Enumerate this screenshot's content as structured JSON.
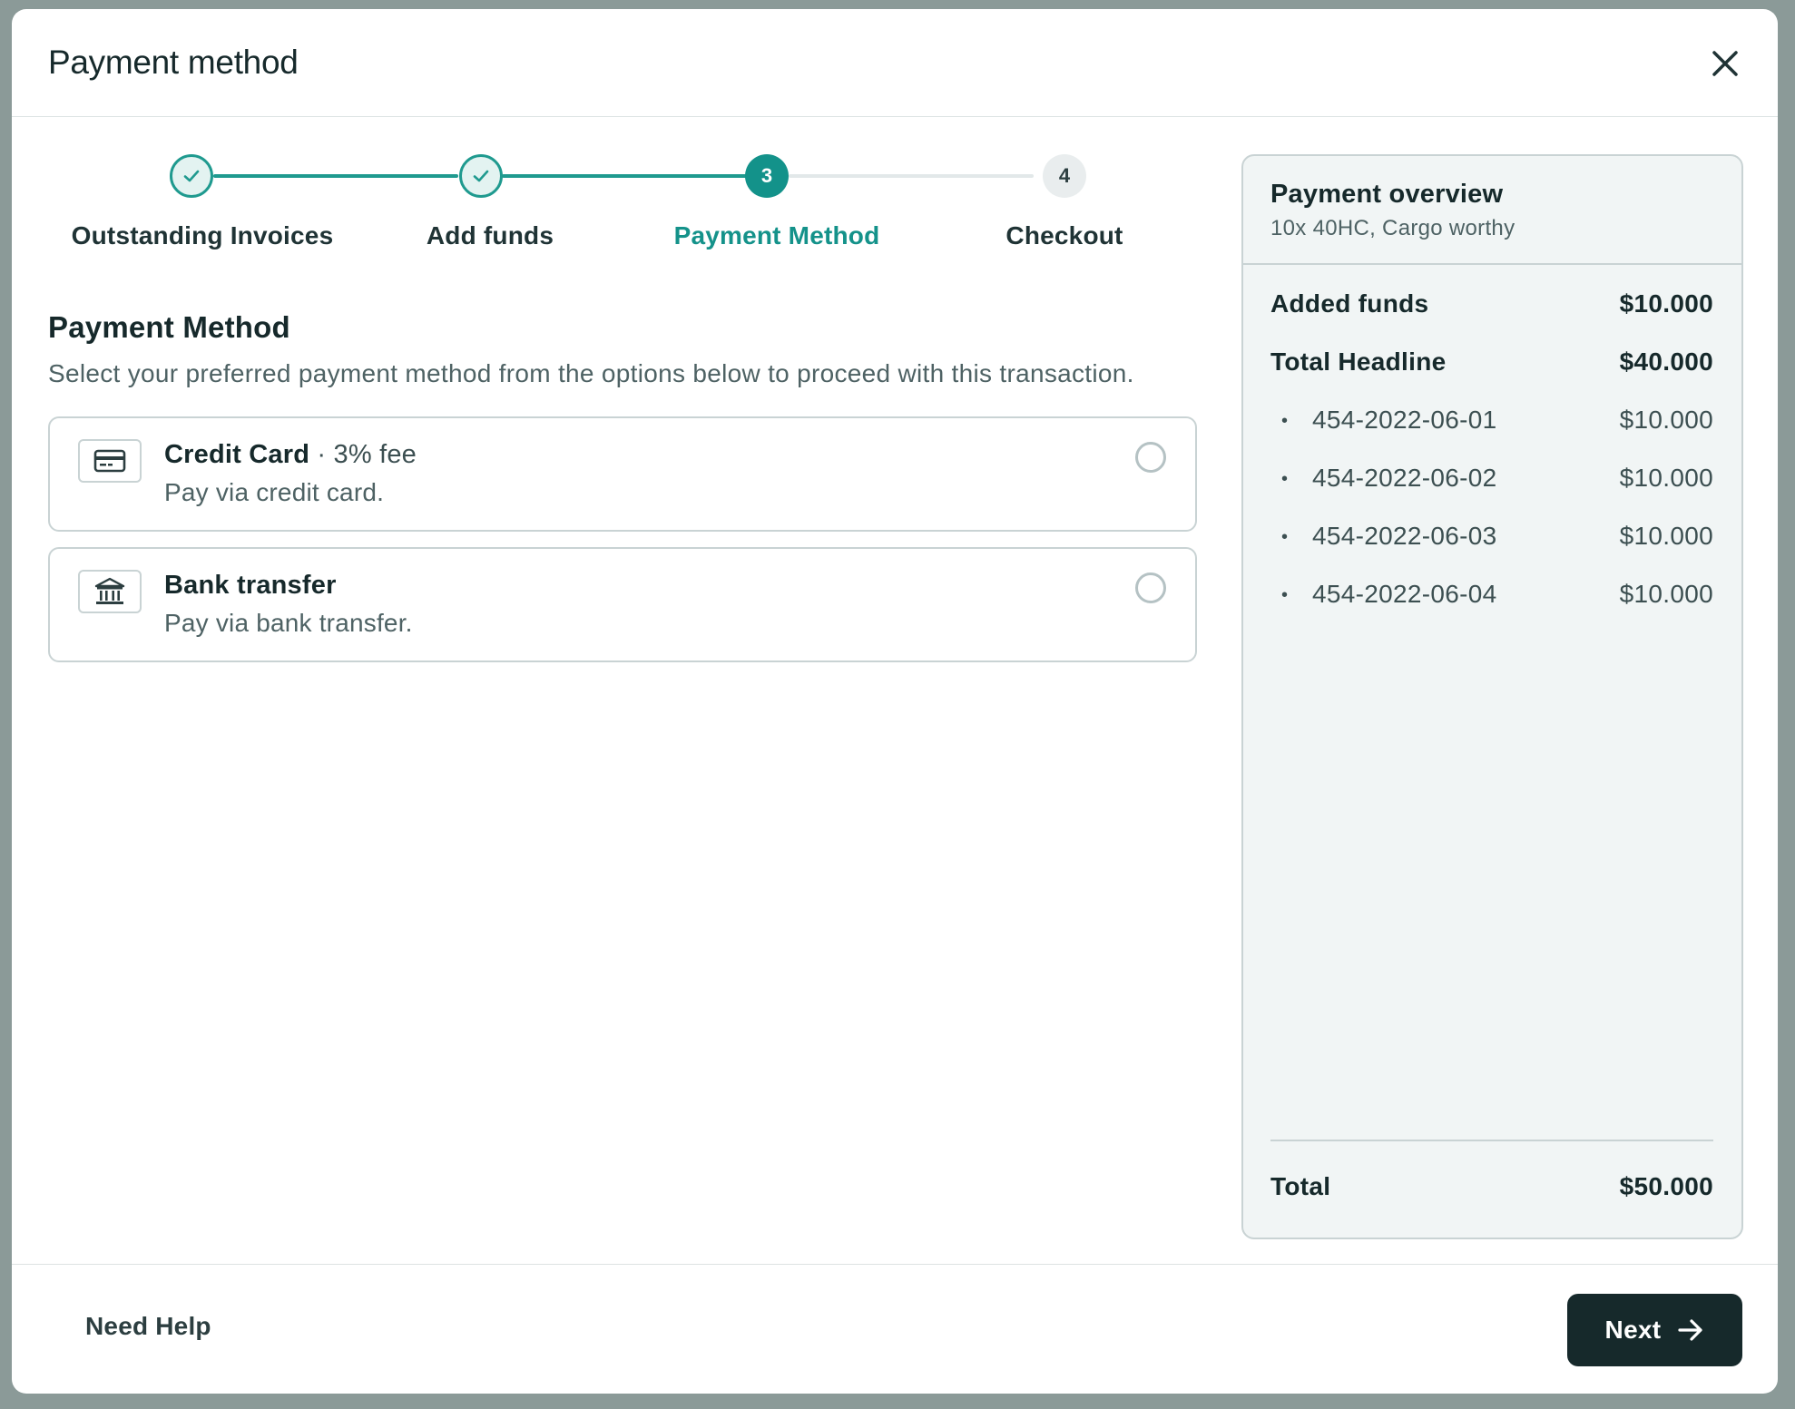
{
  "modal": {
    "title": "Payment method"
  },
  "steps": [
    {
      "label": "Outstanding Invoices",
      "state": "done",
      "number": "1"
    },
    {
      "label": "Add funds",
      "state": "done",
      "number": "2"
    },
    {
      "label": "Payment Method",
      "state": "active",
      "number": "3"
    },
    {
      "label": "Checkout",
      "state": "todo",
      "number": "4"
    }
  ],
  "section": {
    "title": "Payment Method",
    "subtitle": "Select your preferred payment method from the options below to proceed with this transaction."
  },
  "options": [
    {
      "title": "Credit Card",
      "fee": " · 3% fee",
      "description": "Pay via credit card.",
      "icon": "credit-card-icon",
      "selected": false
    },
    {
      "title": "Bank transfer",
      "fee": "",
      "description": "Pay via bank transfer.",
      "icon": "bank-icon",
      "selected": false
    }
  ],
  "overview": {
    "title": "Payment overview",
    "subtitle": "10x 40HC, Cargo worthy",
    "added_funds": {
      "label": "Added funds",
      "value": "$10.000"
    },
    "total_headline": {
      "label": "Total Headline",
      "value": "$40.000"
    },
    "items": [
      {
        "label": "454-2022-06-01",
        "value": "$10.000"
      },
      {
        "label": "454-2022-06-02",
        "value": "$10.000"
      },
      {
        "label": "454-2022-06-03",
        "value": "$10.000"
      },
      {
        "label": "454-2022-06-04",
        "value": "$10.000"
      }
    ],
    "total": {
      "label": "Total",
      "value": "$50.000"
    }
  },
  "footer": {
    "help_label": "Need Help",
    "next_label": "Next"
  },
  "colors": {
    "accent": "#13928a",
    "primary_dark": "#16292b",
    "backdrop": "#8b9a98",
    "panel": "#f1f5f5"
  }
}
